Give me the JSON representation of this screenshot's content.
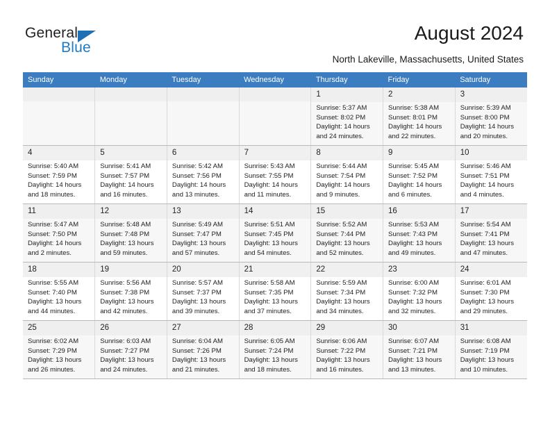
{
  "brand": {
    "name_part1": "General",
    "name_part2": "Blue",
    "triangle_color": "#1f6fb5",
    "blue_color": "#1f7ac4"
  },
  "header": {
    "title": "August 2024",
    "subtitle": "North Lakeville, Massachusetts, United States",
    "header_bg": "#3b7dc0"
  },
  "weekdays": [
    "Sunday",
    "Monday",
    "Tuesday",
    "Wednesday",
    "Thursday",
    "Friday",
    "Saturday"
  ],
  "labels": {
    "sunrise": "Sunrise:",
    "sunset": "Sunset:",
    "daylight": "Daylight:"
  },
  "weeks": [
    [
      {
        "day": "",
        "sunrise": "",
        "sunset": "",
        "daylight_line1": "",
        "daylight_line2": ""
      },
      {
        "day": "",
        "sunrise": "",
        "sunset": "",
        "daylight_line1": "",
        "daylight_line2": ""
      },
      {
        "day": "",
        "sunrise": "",
        "sunset": "",
        "daylight_line1": "",
        "daylight_line2": ""
      },
      {
        "day": "",
        "sunrise": "",
        "sunset": "",
        "daylight_line1": "",
        "daylight_line2": ""
      },
      {
        "day": "1",
        "sunrise": "Sunrise: 5:37 AM",
        "sunset": "Sunset: 8:02 PM",
        "daylight_line1": "Daylight: 14 hours",
        "daylight_line2": "and 24 minutes."
      },
      {
        "day": "2",
        "sunrise": "Sunrise: 5:38 AM",
        "sunset": "Sunset: 8:01 PM",
        "daylight_line1": "Daylight: 14 hours",
        "daylight_line2": "and 22 minutes."
      },
      {
        "day": "3",
        "sunrise": "Sunrise: 5:39 AM",
        "sunset": "Sunset: 8:00 PM",
        "daylight_line1": "Daylight: 14 hours",
        "daylight_line2": "and 20 minutes."
      }
    ],
    [
      {
        "day": "4",
        "sunrise": "Sunrise: 5:40 AM",
        "sunset": "Sunset: 7:59 PM",
        "daylight_line1": "Daylight: 14 hours",
        "daylight_line2": "and 18 minutes."
      },
      {
        "day": "5",
        "sunrise": "Sunrise: 5:41 AM",
        "sunset": "Sunset: 7:57 PM",
        "daylight_line1": "Daylight: 14 hours",
        "daylight_line2": "and 16 minutes."
      },
      {
        "day": "6",
        "sunrise": "Sunrise: 5:42 AM",
        "sunset": "Sunset: 7:56 PM",
        "daylight_line1": "Daylight: 14 hours",
        "daylight_line2": "and 13 minutes."
      },
      {
        "day": "7",
        "sunrise": "Sunrise: 5:43 AM",
        "sunset": "Sunset: 7:55 PM",
        "daylight_line1": "Daylight: 14 hours",
        "daylight_line2": "and 11 minutes."
      },
      {
        "day": "8",
        "sunrise": "Sunrise: 5:44 AM",
        "sunset": "Sunset: 7:54 PM",
        "daylight_line1": "Daylight: 14 hours",
        "daylight_line2": "and 9 minutes."
      },
      {
        "day": "9",
        "sunrise": "Sunrise: 5:45 AM",
        "sunset": "Sunset: 7:52 PM",
        "daylight_line1": "Daylight: 14 hours",
        "daylight_line2": "and 6 minutes."
      },
      {
        "day": "10",
        "sunrise": "Sunrise: 5:46 AM",
        "sunset": "Sunset: 7:51 PM",
        "daylight_line1": "Daylight: 14 hours",
        "daylight_line2": "and 4 minutes."
      }
    ],
    [
      {
        "day": "11",
        "sunrise": "Sunrise: 5:47 AM",
        "sunset": "Sunset: 7:50 PM",
        "daylight_line1": "Daylight: 14 hours",
        "daylight_line2": "and 2 minutes."
      },
      {
        "day": "12",
        "sunrise": "Sunrise: 5:48 AM",
        "sunset": "Sunset: 7:48 PM",
        "daylight_line1": "Daylight: 13 hours",
        "daylight_line2": "and 59 minutes."
      },
      {
        "day": "13",
        "sunrise": "Sunrise: 5:49 AM",
        "sunset": "Sunset: 7:47 PM",
        "daylight_line1": "Daylight: 13 hours",
        "daylight_line2": "and 57 minutes."
      },
      {
        "day": "14",
        "sunrise": "Sunrise: 5:51 AM",
        "sunset": "Sunset: 7:45 PM",
        "daylight_line1": "Daylight: 13 hours",
        "daylight_line2": "and 54 minutes."
      },
      {
        "day": "15",
        "sunrise": "Sunrise: 5:52 AM",
        "sunset": "Sunset: 7:44 PM",
        "daylight_line1": "Daylight: 13 hours",
        "daylight_line2": "and 52 minutes."
      },
      {
        "day": "16",
        "sunrise": "Sunrise: 5:53 AM",
        "sunset": "Sunset: 7:43 PM",
        "daylight_line1": "Daylight: 13 hours",
        "daylight_line2": "and 49 minutes."
      },
      {
        "day": "17",
        "sunrise": "Sunrise: 5:54 AM",
        "sunset": "Sunset: 7:41 PM",
        "daylight_line1": "Daylight: 13 hours",
        "daylight_line2": "and 47 minutes."
      }
    ],
    [
      {
        "day": "18",
        "sunrise": "Sunrise: 5:55 AM",
        "sunset": "Sunset: 7:40 PM",
        "daylight_line1": "Daylight: 13 hours",
        "daylight_line2": "and 44 minutes."
      },
      {
        "day": "19",
        "sunrise": "Sunrise: 5:56 AM",
        "sunset": "Sunset: 7:38 PM",
        "daylight_line1": "Daylight: 13 hours",
        "daylight_line2": "and 42 minutes."
      },
      {
        "day": "20",
        "sunrise": "Sunrise: 5:57 AM",
        "sunset": "Sunset: 7:37 PM",
        "daylight_line1": "Daylight: 13 hours",
        "daylight_line2": "and 39 minutes."
      },
      {
        "day": "21",
        "sunrise": "Sunrise: 5:58 AM",
        "sunset": "Sunset: 7:35 PM",
        "daylight_line1": "Daylight: 13 hours",
        "daylight_line2": "and 37 minutes."
      },
      {
        "day": "22",
        "sunrise": "Sunrise: 5:59 AM",
        "sunset": "Sunset: 7:34 PM",
        "daylight_line1": "Daylight: 13 hours",
        "daylight_line2": "and 34 minutes."
      },
      {
        "day": "23",
        "sunrise": "Sunrise: 6:00 AM",
        "sunset": "Sunset: 7:32 PM",
        "daylight_line1": "Daylight: 13 hours",
        "daylight_line2": "and 32 minutes."
      },
      {
        "day": "24",
        "sunrise": "Sunrise: 6:01 AM",
        "sunset": "Sunset: 7:30 PM",
        "daylight_line1": "Daylight: 13 hours",
        "daylight_line2": "and 29 minutes."
      }
    ],
    [
      {
        "day": "25",
        "sunrise": "Sunrise: 6:02 AM",
        "sunset": "Sunset: 7:29 PM",
        "daylight_line1": "Daylight: 13 hours",
        "daylight_line2": "and 26 minutes."
      },
      {
        "day": "26",
        "sunrise": "Sunrise: 6:03 AM",
        "sunset": "Sunset: 7:27 PM",
        "daylight_line1": "Daylight: 13 hours",
        "daylight_line2": "and 24 minutes."
      },
      {
        "day": "27",
        "sunrise": "Sunrise: 6:04 AM",
        "sunset": "Sunset: 7:26 PM",
        "daylight_line1": "Daylight: 13 hours",
        "daylight_line2": "and 21 minutes."
      },
      {
        "day": "28",
        "sunrise": "Sunrise: 6:05 AM",
        "sunset": "Sunset: 7:24 PM",
        "daylight_line1": "Daylight: 13 hours",
        "daylight_line2": "and 18 minutes."
      },
      {
        "day": "29",
        "sunrise": "Sunrise: 6:06 AM",
        "sunset": "Sunset: 7:22 PM",
        "daylight_line1": "Daylight: 13 hours",
        "daylight_line2": "and 16 minutes."
      },
      {
        "day": "30",
        "sunrise": "Sunrise: 6:07 AM",
        "sunset": "Sunset: 7:21 PM",
        "daylight_line1": "Daylight: 13 hours",
        "daylight_line2": "and 13 minutes."
      },
      {
        "day": "31",
        "sunrise": "Sunrise: 6:08 AM",
        "sunset": "Sunset: 7:19 PM",
        "daylight_line1": "Daylight: 13 hours",
        "daylight_line2": "and 10 minutes."
      }
    ]
  ]
}
